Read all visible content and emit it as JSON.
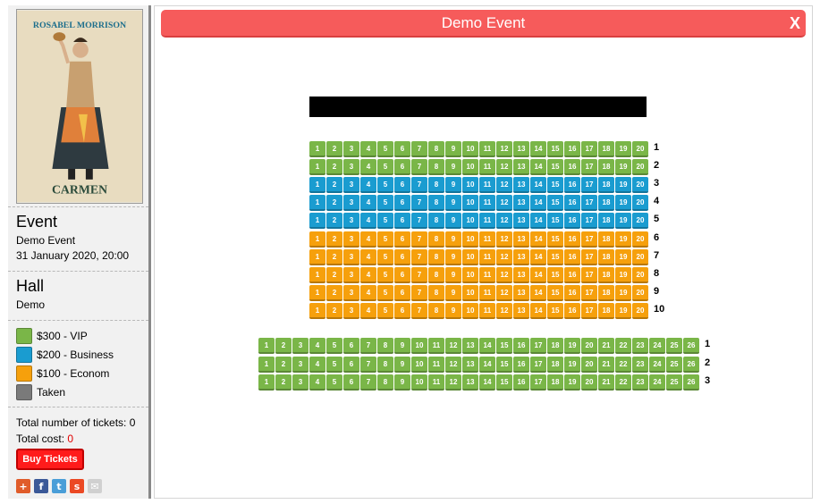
{
  "colors": {
    "vip": "#7ab648",
    "business": "#1a9cd0",
    "econom": "#f6a00c",
    "taken": "#7a7a7a"
  },
  "poster": {
    "title": "ROSABEL MORRISON",
    "subtitle": "CARMEN"
  },
  "event": {
    "heading": "Event",
    "name": "Demo Event",
    "date": "31 January 2020, 20:00"
  },
  "hall": {
    "heading": "Hall",
    "name": "Demo"
  },
  "legend": [
    {
      "label": "$300 - VIP",
      "color": "#7ab648"
    },
    {
      "label": "$200 - Business",
      "color": "#1a9cd0"
    },
    {
      "label": "$100 - Econom",
      "color": "#f6a00c"
    },
    {
      "label": "Taken",
      "color": "#7a7a7a"
    }
  ],
  "totals": {
    "tickets_label": "Total number of tickets: 0",
    "cost_label": "Total cost:",
    "cost_value": "0"
  },
  "buy_button": "Buy Tickets",
  "share_icons": [
    {
      "name": "add-share-icon",
      "glyph": "+",
      "color": "#e05c2a"
    },
    {
      "name": "facebook-icon",
      "glyph": "f",
      "color": "#3b5998"
    },
    {
      "name": "twitter-icon",
      "glyph": "t",
      "color": "#4a9ed8"
    },
    {
      "name": "stumbleupon-icon",
      "glyph": "s",
      "color": "#eb4924"
    },
    {
      "name": "email-icon",
      "glyph": "✉",
      "color": "#d0d0d0"
    }
  ],
  "modal": {
    "title": "Demo Event",
    "close_label": "X"
  },
  "sections": [
    {
      "seats_per_row": 20,
      "rows": [
        {
          "label": "1",
          "tier": "vip"
        },
        {
          "label": "2",
          "tier": "vip"
        },
        {
          "label": "3",
          "tier": "business"
        },
        {
          "label": "4",
          "tier": "business"
        },
        {
          "label": "5",
          "tier": "business"
        },
        {
          "label": "6",
          "tier": "econom"
        },
        {
          "label": "7",
          "tier": "econom"
        },
        {
          "label": "8",
          "tier": "econom"
        },
        {
          "label": "9",
          "tier": "econom"
        },
        {
          "label": "10",
          "tier": "econom"
        }
      ]
    },
    {
      "seats_per_row": 26,
      "rows": [
        {
          "label": "1",
          "tier": "vip"
        },
        {
          "label": "2",
          "tier": "vip"
        },
        {
          "label": "3",
          "tier": "vip"
        }
      ]
    }
  ]
}
